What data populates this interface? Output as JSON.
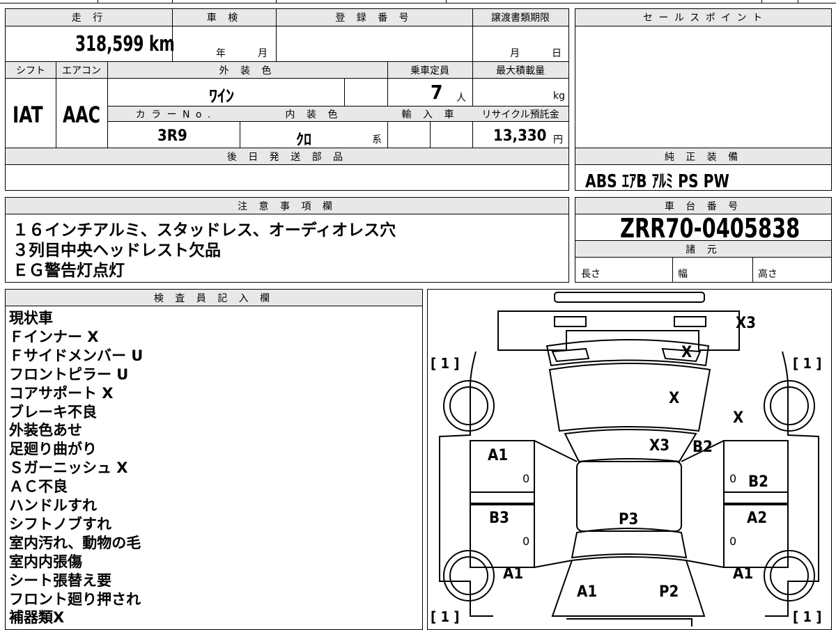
{
  "top_sheet": {
    "headers": {
      "mileage": "走 行",
      "inspection": "車 検",
      "registration": "登 録 番 号",
      "transfer_deadline": "譲渡書類期限",
      "shift": "シフト",
      "aircon": "エアコン",
      "exterior_color": "外 装 色",
      "capacity": "乗車定員",
      "max_load": "最大積載量",
      "color_no": "カ ラ ー N o .",
      "interior_color": "内 装 色",
      "import": "輸 入 車",
      "recycle_fee": "リサイクル預託金",
      "later_parts": "後 日 発 送 部 品"
    },
    "values": {
      "mileage": "318,599 km",
      "year_unit": "年",
      "month_unit": "月",
      "deadline_month": "月",
      "deadline_day": "日",
      "shift": "IAT",
      "aircon": "AAC",
      "exterior_color": "ﾜｲﾝ",
      "capacity_num": "7",
      "capacity_unit": "人",
      "load_unit": "kg",
      "color_no": "3R9",
      "interior_color": "ｸﾛ",
      "interior_suffix": "系",
      "recycle_fee": "13,330",
      "recycle_unit": "円"
    }
  },
  "sales_point": {
    "header": "セ ー ル ス ポ イ ン ト"
  },
  "genuine_equipment": {
    "header": "純 正 装 備",
    "value": "ABS ｴｱB ｱﾙﾐ PS PW"
  },
  "notes": {
    "header": "注 意 事 項 欄",
    "lines": [
      "１６インチアルミ、スタッドレス、オーディオレス穴",
      "３列目中央ヘッドレスト欠品",
      "ＥＧ警告灯点灯"
    ]
  },
  "chassis": {
    "header": "車 台 番 号",
    "value": "ZRR70-0405838",
    "spec_header": "諸 元",
    "length": "長さ",
    "width": "幅",
    "height": "高さ"
  },
  "inspector": {
    "header": "検 査 員 記 入 欄",
    "lines": [
      "現状車",
      "Ｆインナー X",
      "Ｆサイドメンバー U",
      "フロントピラー U",
      "コアサポート X",
      "ブレーキ不良",
      "外装色あせ",
      "足廻り曲がり",
      "Ｓガーニッシュ X",
      "ＡＣ不良",
      "ハンドルすれ",
      "シフトノブすれ",
      "室内汚れ、動物の毛",
      "室内内張傷",
      "シート張替え要",
      "フロント廻り押され",
      "補器類X"
    ]
  },
  "diagram": {
    "marks": {
      "x3_top": "X3",
      "x_front_glass": "X",
      "x_hood": "X",
      "x_right_fender": "X",
      "x3_cowl": "X3",
      "b2_fender": "B2",
      "a1_left_front_door": "A1",
      "b2_right_front_door": "B2",
      "b3_left_rear_door": "B3",
      "p3_roof": "P3",
      "a2_right_rear_door": "A2",
      "a1_left_quarter": "A1",
      "a1_right_quarter": "A1",
      "a1_rear_left": "A1",
      "p2_rear_right": "P2",
      "zero_1": "0",
      "zero_2": "0",
      "zero_3": "0",
      "zero_4": "0",
      "tire_fl": "[ 1 ]",
      "tire_fr": "[ 1 ]",
      "tire_rl": "[ 1 ]",
      "tire_rr": "[ 1 ]"
    }
  }
}
